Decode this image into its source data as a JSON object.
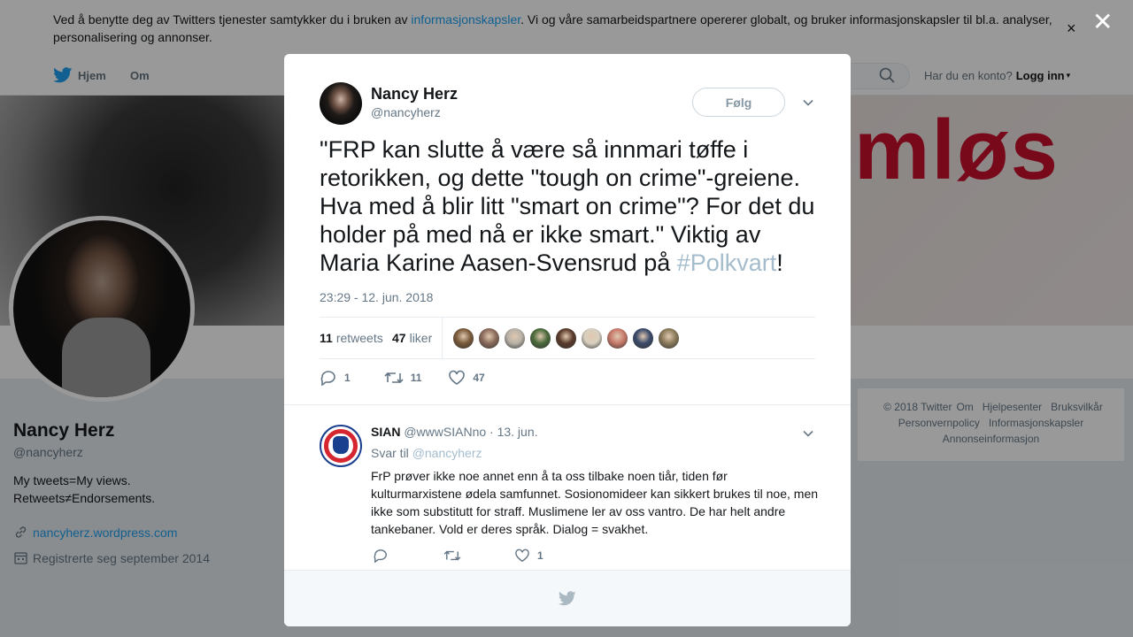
{
  "cookie_banner": {
    "text_before": "Ved å benytte deg av Twitters tjenester samtykker du i bruken av ",
    "link_text": "informasjonskapsler",
    "text_after": ". Vi og våre samarbeidspartnere opererer globalt, og bruker informasjonskapsler til bl.a. analyser, personalisering og annonser.",
    "close_label": "×"
  },
  "nav": {
    "home": "Hjem",
    "about": "Om",
    "have_account": "Har du en konto?",
    "login": "Logg inn",
    "login_caret": "▾"
  },
  "banner": {
    "text": "mløs"
  },
  "profile": {
    "name": "Nancy Herz",
    "handle": "@nancyherz",
    "bio_line1": "My tweets=My views.",
    "bio_line2": "Retweets≠Endorsements.",
    "url": "nancyherz.wordpress.com",
    "joined": "Registrerte seg september 2014"
  },
  "footer": {
    "links": [
      "© 2018 Twitter",
      "Om",
      "Hjelpesenter",
      "Bruksvilkår",
      "Personvernpolicy",
      "Informasjonskapsler",
      "Annonseinformasjon"
    ]
  },
  "overlay": {
    "close_label": "✕"
  },
  "tweet": {
    "author_name": "Nancy Herz",
    "author_handle": "@nancyherz",
    "follow_label": "Følg",
    "text_main": "\"FRP kan slutte å være så innmari tøffe i retorikken, og dette \"tough on crime\"-greiene. Hva med å blir litt \"smart on crime\"? For det du holder på med nå er ikke smart.\" Viktig av Maria Karine Aasen-Svensrud på ",
    "hashtag": "#Polkvart",
    "text_end": "!",
    "timestamp": "23:29 - 12. jun. 2018",
    "retweets_count": "11",
    "retweets_label": "retweets",
    "likes_count": "47",
    "likes_label": "liker",
    "liker_colors": [
      "#7a5a3a",
      "#8a6a5a",
      "#b8b2a8",
      "#4a6a3a",
      "#5a3a2a",
      "#d8d0c0",
      "#c87a6a",
      "#3a4a6a",
      "#8a7a5a"
    ],
    "reply_count": "1",
    "retweet_action_count": "11",
    "like_action_count": "47"
  },
  "reply": {
    "author_name": "SIAN",
    "author_handle": "@wwwSIANno",
    "date": "· 13. jun.",
    "reply_to_prefix": "Svar til",
    "reply_to_handle": "@nancyherz",
    "text": "FrP prøver ikke noe annet enn å ta oss tilbake noen tiår, tiden før kulturmarxistene ødela samfunnet. Sosionomideer kan sikkert brukes til noe, men ikke som substitutt for straff. Muslimene ler av oss vantro. De har helt andre tankebaner. Vold er deres språk. Dialog = svakhet.",
    "like_count": "1"
  }
}
